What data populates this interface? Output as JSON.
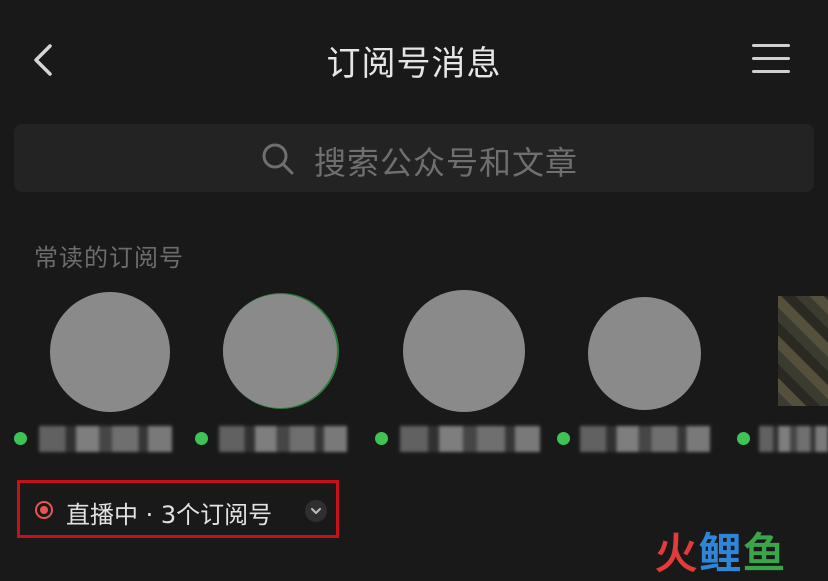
{
  "header": {
    "title": "订阅号消息",
    "back_icon": "chevron-left-icon",
    "menu_icon": "hamburger-menu-icon"
  },
  "search": {
    "placeholder": "搜索公众号和文章",
    "icon": "search-icon"
  },
  "frequent": {
    "section_title": "常读的订阅号",
    "accounts": [
      {
        "name": "",
        "online": true
      },
      {
        "name": "",
        "online": true
      },
      {
        "name": "",
        "online": true
      },
      {
        "name": "",
        "online": true
      },
      {
        "name": "",
        "online": true
      }
    ]
  },
  "live": {
    "label": "直播中 · 3个订阅号",
    "icon": "live-record-icon",
    "expand_icon": "chevron-down-icon"
  },
  "watermark": {
    "part1": "火",
    "part2": "鲤",
    "part3": "鱼"
  },
  "colors": {
    "background": "#191919",
    "online_dot": "#3ec455",
    "live_red": "#e8554f",
    "highlight_box": "#c7101a"
  }
}
